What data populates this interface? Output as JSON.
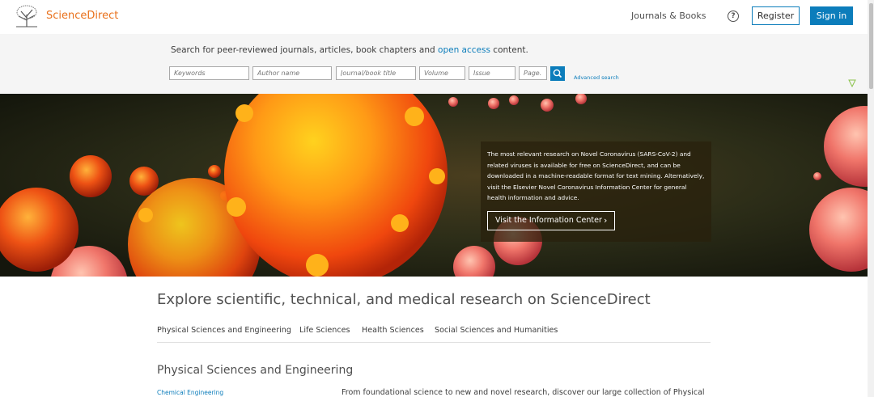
{
  "header": {
    "brand": "ScienceDirect",
    "journals_books": "Journals & Books",
    "help_symbol": "?",
    "register": "Register",
    "sign_in": "Sign in"
  },
  "search": {
    "intro_before": "Search for peer-reviewed journals, articles, book chapters and ",
    "intro_link": "open access",
    "intro_after": " content.",
    "placeholders": {
      "keywords": "Keywords",
      "author": "Author name",
      "journal": "Journal/book title",
      "volume": "Volume",
      "issue": "Issue",
      "page": "Page."
    },
    "advanced": "Advanced search"
  },
  "hero": {
    "info_text": "The most relevant research on Novel Coronavirus (SARS-CoV-2) and related viruses is available for free on ScienceDirect, and can be downloaded in a machine-readable format for text mining. Alternatively, visit the Elsevier Novel Coronavirus Information Center for general health information and advice.",
    "button": "Visit the Information Center",
    "button_chevron": "›"
  },
  "explore": {
    "title": "Explore scientific, technical, and medical research on ScienceDirect",
    "tabs": [
      "Physical Sciences and Engineering",
      "Life Sciences",
      "Health Sciences",
      "Social Sciences and Humanities"
    ],
    "section_title": "Physical Sciences and Engineering",
    "first_subject": "Chemical Engineering",
    "description": "From foundational science to new and novel research, discover our large collection of Physical"
  },
  "colors": {
    "brand_orange": "#e9711c",
    "link_blue": "#0c7dbb"
  }
}
